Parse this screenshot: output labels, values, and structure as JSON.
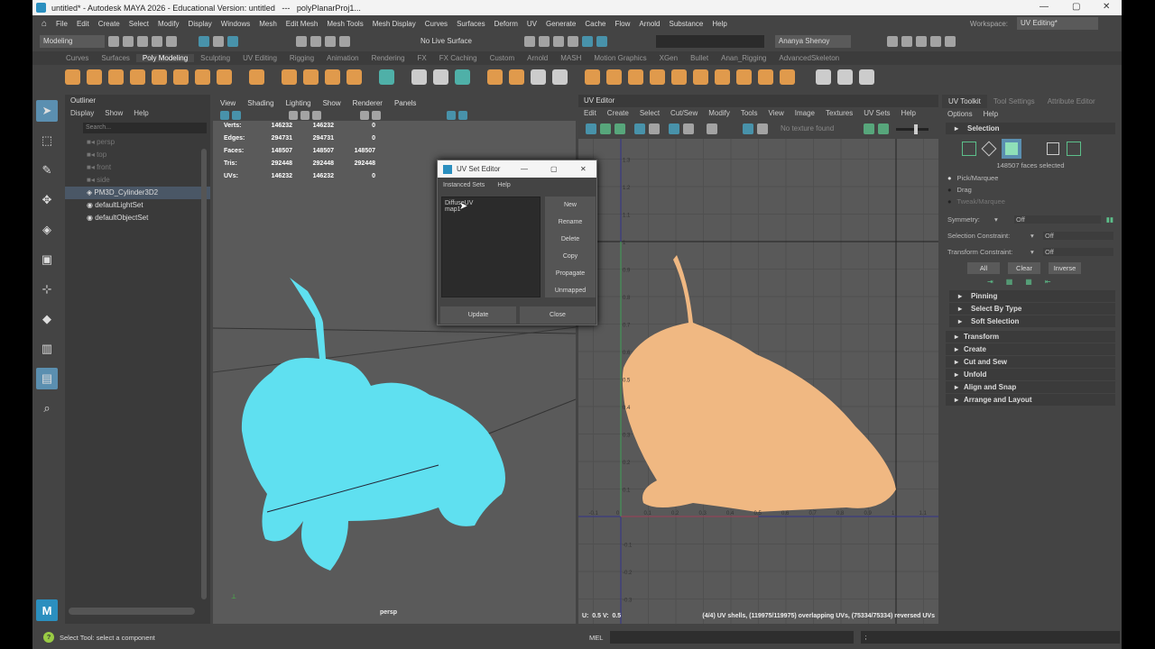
{
  "title": "untitled* - Autodesk MAYA 2026 - Educational Version: untitled   ---   polyPlanarProj1...",
  "menus": [
    "File",
    "Edit",
    "Create",
    "Select",
    "Modify",
    "Display",
    "Windows",
    "Mesh",
    "Edit Mesh",
    "Mesh Tools",
    "Mesh Display",
    "Curves",
    "Surfaces",
    "Deform",
    "UV",
    "Generate",
    "Cache",
    "Flow",
    "Arnold",
    "Substance",
    "Help"
  ],
  "workspace_label": "Workspace:",
  "workspace": "UV Editing*",
  "mode": "Modeling",
  "live_surface": "No Live Surface",
  "user": "Ananya Shenoy",
  "shelf_tabs": [
    "Curves",
    "Surfaces",
    "Poly Modeling",
    "Sculpting",
    "UV Editing",
    "Rigging",
    "Animation",
    "Rendering",
    "FX",
    "FX Caching",
    "Custom",
    "Arnold",
    "MASH",
    "Motion Graphics",
    "XGen",
    "Bullet",
    "Anan_Rigging",
    "AdvancedSkeleton"
  ],
  "outliner": {
    "title": "Outliner",
    "menu": [
      "Display",
      "Show",
      "Help"
    ],
    "search_placeholder": "Search...",
    "items": [
      "persp",
      "top",
      "front",
      "side",
      "PM3D_Cylinder3D2",
      "defaultLightSet",
      "defaultObjectSet"
    ]
  },
  "viewport": {
    "menu": [
      "View",
      "Shading",
      "Lighting",
      "Show",
      "Renderer",
      "Panels"
    ],
    "camera": "persp",
    "hud": [
      [
        "Verts:",
        "146232",
        "146232",
        "0"
      ],
      [
        "Edges:",
        "294731",
        "294731",
        "0"
      ],
      [
        "Faces:",
        "148507",
        "148507",
        "148507"
      ],
      [
        "Tris:",
        "292448",
        "292448",
        "292448"
      ],
      [
        "UVs:",
        "146232",
        "146232",
        "0"
      ]
    ]
  },
  "uv_set_editor": {
    "title": "UV Set Editor",
    "menu": [
      "Instanced Sets",
      "Help"
    ],
    "sets": [
      "DiffuseUV",
      "map1"
    ],
    "buttons": [
      "New",
      "Rename",
      "Delete",
      "Copy",
      "Propagate",
      "Unmapped"
    ],
    "update": "Update",
    "close": "Close"
  },
  "uv_editor": {
    "title": "UV Editor",
    "menu": [
      "Edit",
      "Create",
      "Select",
      "Cut/Sew",
      "Modify",
      "Tools",
      "View",
      "Image",
      "Textures",
      "UV Sets",
      "Help"
    ],
    "texture": "No texture found",
    "u_ticks": [
      "-0.1",
      "0",
      "0.1",
      "0.2",
      "0.3",
      "0.4",
      "0.5",
      "0.6",
      "0.7",
      "0.8",
      "0.9",
      "1",
      "1.1"
    ],
    "v_ticks": [
      "1.3",
      "1.2",
      "1.1",
      "1",
      "0.9",
      "0.8",
      "0.7",
      "0.6",
      "0.5",
      "0.4",
      "0.3",
      "0.2",
      "0.1",
      "-0.1",
      "-0.2",
      "-0.3"
    ],
    "uv_readout": "U:  0.5 V:  0.5",
    "stats": "(4/4) UV shells, (119975/119975) overlapping UVs, (75334/75334) reversed UVs"
  },
  "toolkit": {
    "tabs": [
      "UV Toolkit",
      "Tool Settings",
      "Attribute Editor"
    ],
    "menu": [
      "Options",
      "Help"
    ],
    "selection": "Selection",
    "faces_selected": "148507 faces selected",
    "modes": [
      "Pick/Marquee",
      "Drag",
      "Tweak/Marquee"
    ],
    "symmetry_label": "Symmetry:",
    "symmetry": "Off",
    "sel_constraint_label": "Selection Constraint:",
    "sel_constraint": "Off",
    "tr_constraint_label": "Transform Constraint:",
    "tr_constraint": "Off",
    "buttons": [
      "All",
      "Clear",
      "Inverse"
    ],
    "subsections": [
      "Pinning",
      "Select By Type",
      "Soft Selection"
    ],
    "sections": [
      "Transform",
      "Create",
      "Cut and Sew",
      "Unfold",
      "Align and Snap",
      "Arrange and Layout"
    ]
  },
  "help_line": "Select Tool: select a component",
  "mel_label": "MEL",
  "mel_result": ";",
  "colors": {
    "mesh_viewport": "#5fe0f0",
    "mesh_uv": "#f0b882",
    "accent": "#5b8fb0"
  }
}
